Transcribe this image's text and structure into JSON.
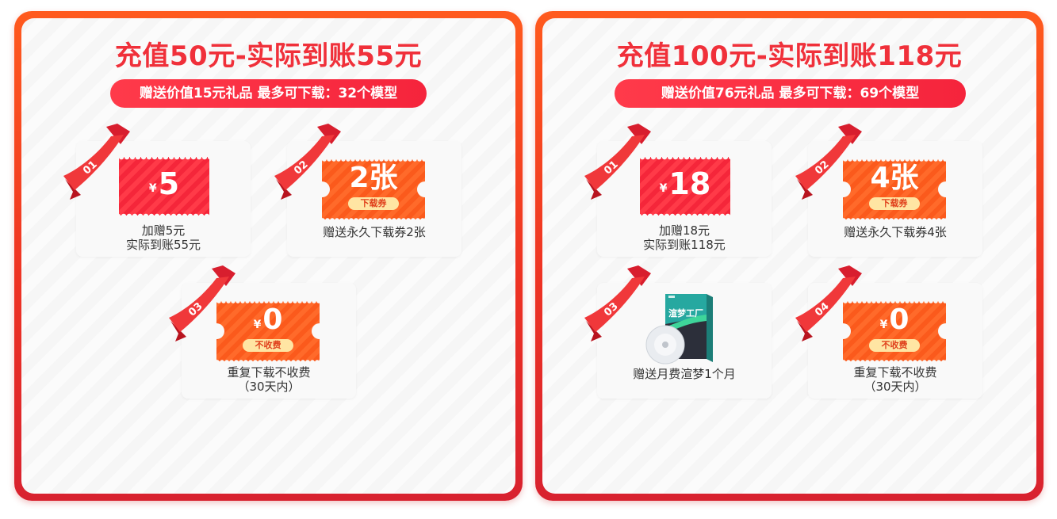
{
  "panels": [
    {
      "title": "充值50元-实际到账55元",
      "subtitle": "赠送价值15元礼品 最多可下载：32个模型",
      "cards": [
        {
          "num": "01",
          "coupon": "red",
          "currency": "¥",
          "value": "5",
          "caption": [
            "加赠5元",
            "实际到账55元"
          ]
        },
        {
          "num": "02",
          "coupon": "orange",
          "value": "2张",
          "tag": "下载券",
          "caption": [
            "赠送永久下载券2张"
          ]
        },
        {
          "num": "03",
          "coupon": "orange",
          "currency": "¥",
          "value": "0",
          "tag": "不收费",
          "caption": [
            "重复下载不收费",
            "（30天内）"
          ]
        }
      ]
    },
    {
      "title": "充值100元-实际到账118元",
      "subtitle": "赠送价值76元礼品 最多可下载：69个模型",
      "cards": [
        {
          "num": "01",
          "coupon": "red",
          "currency": "¥",
          "value": "18",
          "caption": [
            "加赠18元",
            "实际到账118元"
          ]
        },
        {
          "num": "02",
          "coupon": "orange",
          "value": "4张",
          "tag": "下载券",
          "caption": [
            "赠送永久下载券4张"
          ]
        },
        {
          "num": "03",
          "coupon": "product",
          "product_label": "渲梦工厂",
          "caption": [
            "赠送月费渲梦1个月"
          ]
        },
        {
          "num": "04",
          "coupon": "orange",
          "currency": "¥",
          "value": "0",
          "tag": "不收费",
          "caption": [
            "重复下载不收费",
            "（30天内）"
          ]
        }
      ]
    }
  ],
  "colors": {
    "title_red": "#f0303a",
    "panel_border": "#ee3324",
    "coupon_red": "#f5263a",
    "coupon_orange": "#fb5a1c",
    "tag_bg": "#ffe5a3"
  }
}
